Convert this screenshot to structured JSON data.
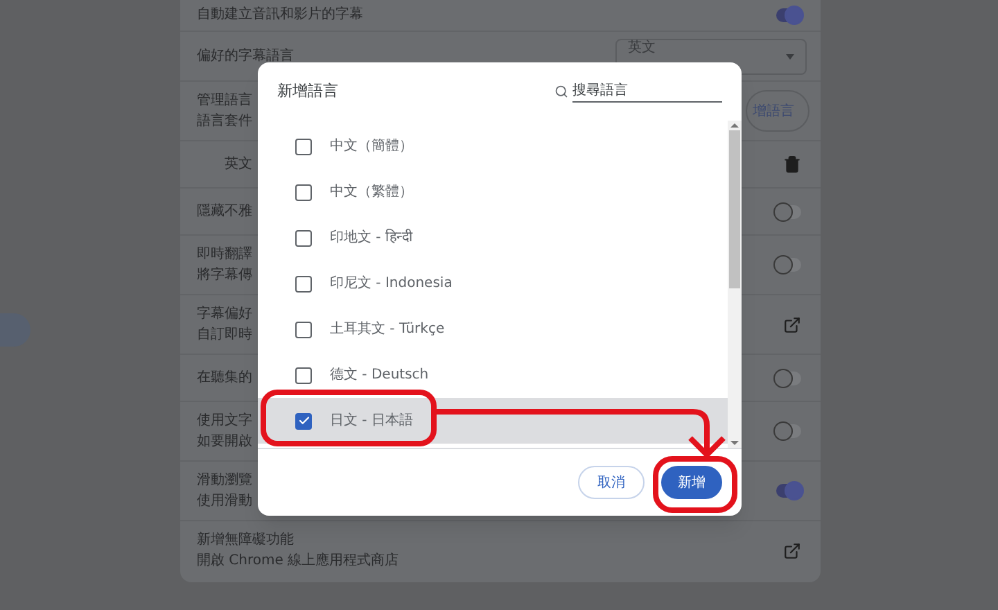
{
  "settings": {
    "rows": [
      {
        "kind": "toggle",
        "title": "自動建立音訊和影片的字幕",
        "on": true
      },
      {
        "kind": "dropdown",
        "title": "偏好的字幕語言",
        "value": "英文"
      },
      {
        "kind": "button",
        "title": "管理語言",
        "subtitle": "語言套件",
        "button": "增語言"
      },
      {
        "kind": "language",
        "title": "英文"
      },
      {
        "kind": "toggle",
        "title": "隱藏不雅",
        "on": false
      },
      {
        "kind": "toggle",
        "title": "即時翻譯",
        "subtitle": "將字幕傳",
        "on": false
      },
      {
        "kind": "link",
        "title": "字幕偏好",
        "subtitle": "自訂即時"
      },
      {
        "kind": "toggle",
        "title": "在聽集的",
        "on": false
      },
      {
        "kind": "toggle",
        "title": "使用文字",
        "subtitle": "如要開啟",
        "on": false
      },
      {
        "kind": "toggle",
        "title": "滑動瀏覽",
        "subtitle": "使用滑動",
        "on": true
      },
      {
        "kind": "link",
        "title": "新增無障礙功能",
        "subtitle": "開啟 Chrome 線上應用程式商店"
      }
    ]
  },
  "dialog": {
    "title": "新增語言",
    "search": {
      "placeholder": "搜尋語言"
    },
    "languages": [
      {
        "label": "中文（簡體）",
        "checked": false,
        "selected": false
      },
      {
        "label": "中文（繁體）",
        "checked": false,
        "selected": false
      },
      {
        "label": "印地文 - हिन्दी",
        "checked": false,
        "selected": false
      },
      {
        "label": "印尼文 - Indonesia",
        "checked": false,
        "selected": false
      },
      {
        "label": "土耳其文 - Türkçe",
        "checked": false,
        "selected": false
      },
      {
        "label": "德文 - Deutsch",
        "checked": false,
        "selected": false
      },
      {
        "label": "日文 - 日本語",
        "checked": true,
        "selected": true
      }
    ],
    "buttons": {
      "cancel": "取消",
      "confirm": "新增"
    }
  }
}
